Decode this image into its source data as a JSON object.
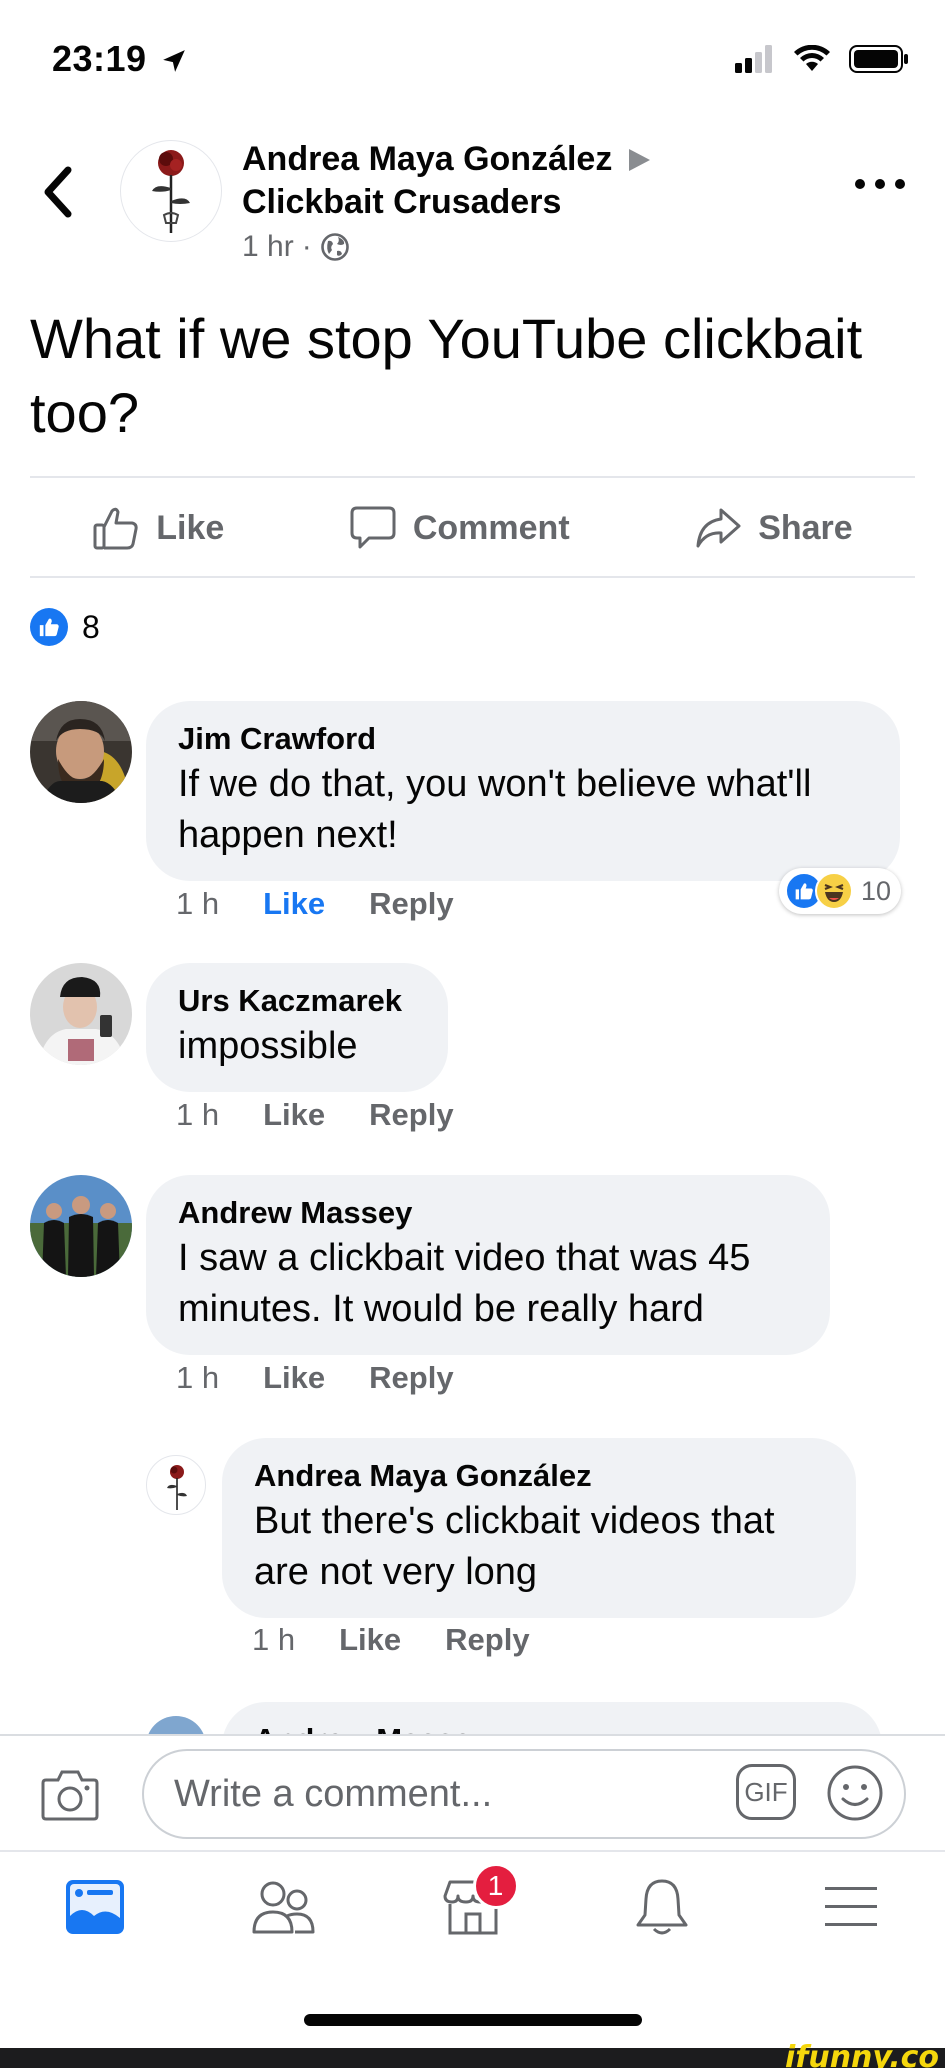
{
  "status_bar": {
    "time": "23:19"
  },
  "post": {
    "author": "Andrea Maya González",
    "group": "Clickbait Crusaders",
    "time": "1 hr",
    "separator": "·",
    "text": "What if we stop YouTube clickbait too?",
    "actions": {
      "like": "Like",
      "comment": "Comment",
      "share": "Share"
    },
    "like_count": "8"
  },
  "comments": [
    {
      "name": "Jim Crawford",
      "text": "If we do that, you won't believe what'll happen next!",
      "time": "1 h",
      "like": "Like",
      "reply": "Reply",
      "reaction_count": "10"
    },
    {
      "name": "Urs Kaczmarek",
      "text": "impossible",
      "time": "1 h",
      "like": "Like",
      "reply": "Reply"
    },
    {
      "name": "Andrew Massey",
      "text": "I saw a clickbait video that was 45 minutes. It would be really hard",
      "time": "1 h",
      "like": "Like",
      "reply": "Reply"
    },
    {
      "name": "Andrea Maya González",
      "text": "But there's clickbait videos that are not very long",
      "time": "1 h",
      "like": "Like",
      "reply": "Reply"
    },
    {
      "name": "Andrew Massey"
    }
  ],
  "composer": {
    "placeholder": "Write a comment...",
    "gif_label": "GIF"
  },
  "nav": {
    "marketplace_badge": "1"
  },
  "watermark": "ifunny.co",
  "colors": {
    "accent": "#1877f2",
    "badge": "#e41e3f",
    "bubble": "#f0f2f5",
    "secondary_text": "#65676b"
  }
}
